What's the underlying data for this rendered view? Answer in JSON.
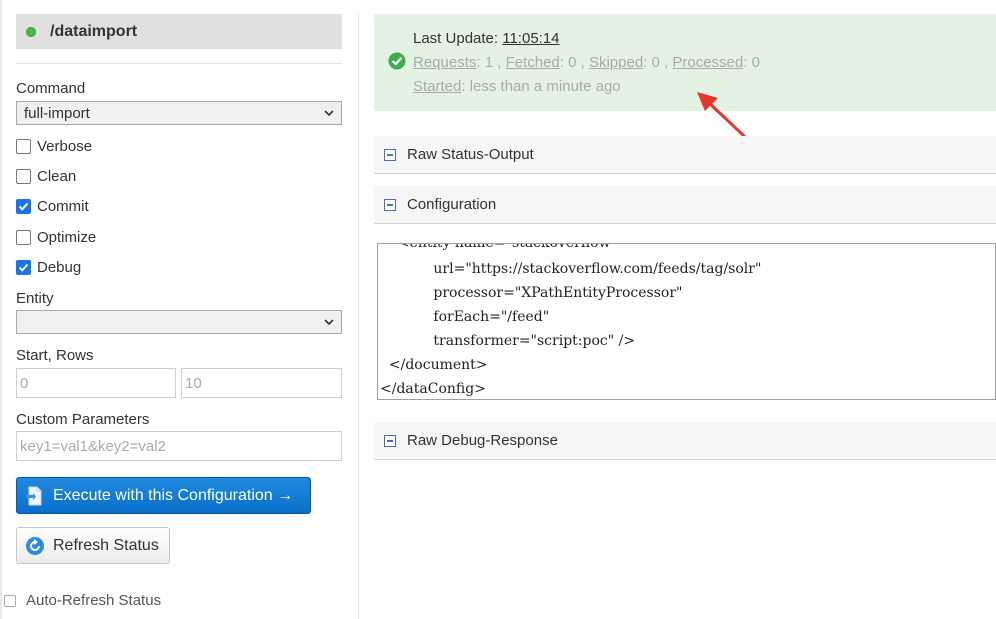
{
  "left_panel": {
    "handler_name": "/dataimport",
    "command_label": "Command",
    "command_value": "full-import",
    "options": [
      {
        "label": "Verbose",
        "checked": false
      },
      {
        "label": "Clean",
        "checked": false
      },
      {
        "label": "Commit",
        "checked": true
      },
      {
        "label": "Optimize",
        "checked": false
      },
      {
        "label": "Debug",
        "checked": true
      }
    ],
    "entity_label": "Entity",
    "entity_value": "",
    "start_rows_label": "Start, Rows",
    "start_placeholder": "0",
    "rows_placeholder": "10",
    "custom_params_label": "Custom Parameters",
    "custom_params_placeholder": "key1=val1&key2=val2",
    "execute_button": "Execute with this Configuration →",
    "refresh_button": "Refresh Status",
    "auto_refresh_label": "Auto-Refresh Status"
  },
  "status": {
    "last_update_label": "Last Update:",
    "last_update_value": "11:05:14",
    "requests_label": "Requests",
    "requests_value": ": 1 ,",
    "fetched_label": "Fetched",
    "fetched_value": ": 0 ,",
    "skipped_label": "Skipped",
    "skipped_value": ": 0 ,",
    "processed_label": "Processed",
    "processed_value": ": 0",
    "started_label": "Started",
    "started_value": ": less than a minute ago"
  },
  "sections": {
    "raw_status": "Raw Status-Output",
    "configuration": "Configuration",
    "raw_debug": "Raw Debug-Response"
  },
  "config_lines": [
    "    <entity name=\"stackoverflow\"",
    "            url=\"https://stackoverflow.com/feeds/tag/solr\"",
    "            processor=\"XPathEntityProcessor\"",
    "            forEach=\"/feed\"",
    "            transformer=\"script:poc\" />",
    "  </document>",
    "</dataConfig>"
  ],
  "colors": {
    "status_bg": "#e4f2e4",
    "primary_button": "#0a6fc9",
    "checkbox_checked": "#1a73e8",
    "annotation_arrow": "#e8352a"
  }
}
